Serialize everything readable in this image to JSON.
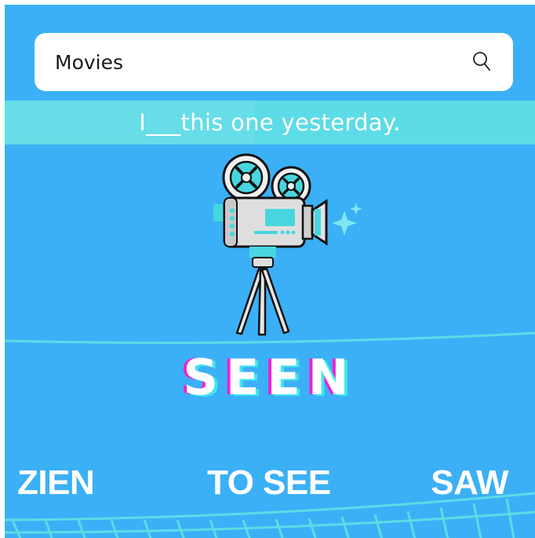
{
  "search": {
    "value": "Movies",
    "icon": "search-icon"
  },
  "prompt": {
    "sentence": "I___this one yesterday."
  },
  "illustration": {
    "icon": "movie-camera-icon",
    "sparkle": "sparkle-icon"
  },
  "answer": {
    "word": "SEEN"
  },
  "options": [
    {
      "label": "ZIEN"
    },
    {
      "label": "TO SEE"
    },
    {
      "label": "SAW"
    }
  ],
  "colors": {
    "background": "#3bb0f6",
    "band": "#5ddbe6",
    "accent_pink": "#ee22d6",
    "accent_cyan": "#3fe8ee",
    "text": "#ffffff"
  }
}
